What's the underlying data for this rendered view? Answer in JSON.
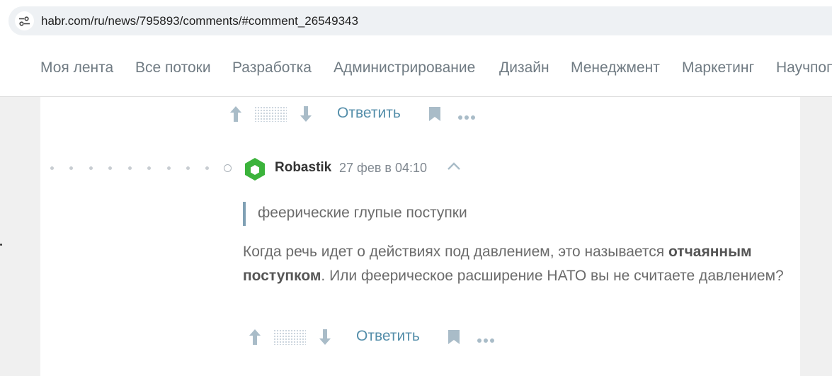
{
  "browser": {
    "url": "habr.com/ru/news/795893/comments/#comment_26549343"
  },
  "nav": {
    "items": [
      "Моя лента",
      "Все потоки",
      "Разработка",
      "Администрирование",
      "Дизайн",
      "Менеджмент",
      "Маркетинг",
      "Научпоп"
    ]
  },
  "previous_comment": {
    "reply_label": "Ответить"
  },
  "comment": {
    "author": "Robastik",
    "timestamp": "27 фев в 04:10",
    "quote": "феерические глупые поступки",
    "body_part1": "Когда речь идет о действиях под давлением, это называется ",
    "body_bold": "отчаянным поступком",
    "body_part2": ". Или феерическое расширение НАТО вы не считаете давлением?",
    "reply_label": "Ответить"
  },
  "icons": {
    "site_info": "site-settings-icon",
    "avatar": "hexagon-avatar-icon",
    "upvote": "arrow-up-icon",
    "downvote": "arrow-down-icon",
    "bookmark": "bookmark-icon",
    "more": "more-dots-icon",
    "collapse": "chevron-up-icon"
  },
  "colors": {
    "link": "#548eaa",
    "avatar_green": "#3bb33b",
    "nav_text": "#707b83",
    "icon_muted": "#a9bcc8"
  }
}
